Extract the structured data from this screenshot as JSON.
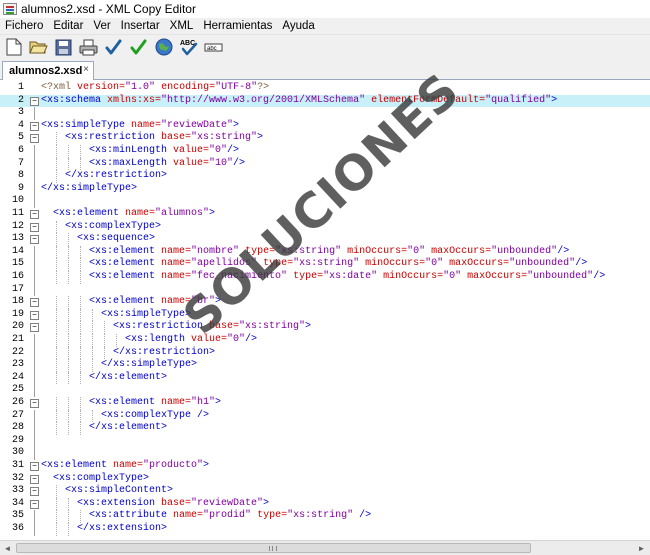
{
  "window": {
    "title": "alumnos2.xsd - XML Copy Editor"
  },
  "menubar": {
    "items": [
      "Fichero",
      "Editar",
      "Ver",
      "Insertar",
      "XML",
      "Herramientas",
      "Ayuda"
    ]
  },
  "toolbar": {
    "buttons": [
      "new-document-icon",
      "open-folder-icon",
      "save-icon",
      "print-icon",
      "check-wellformed-icon",
      "validate-icon",
      "browser-preview-icon",
      "spellcheck-icon",
      "spellcheck-alt-icon"
    ],
    "spell_label": "ABC",
    "spell_alt_label": "abc"
  },
  "tabs": [
    {
      "label": "alumnos2.xsd",
      "close": "×"
    }
  ],
  "editor": {
    "current_line": 2,
    "lines": [
      {
        "n": "1",
        "fold": "",
        "indent": 0,
        "tokens": [
          [
            "pi",
            "<?xml "
          ],
          [
            "attr",
            "version="
          ],
          [
            "val",
            "\"1.0\""
          ],
          [
            "pi",
            " "
          ],
          [
            "attr",
            "encoding="
          ],
          [
            "val",
            "\"UTF-8\""
          ],
          [
            "pi",
            "?>"
          ]
        ]
      },
      {
        "n": "2",
        "fold": "-",
        "indent": 0,
        "tokens": [
          [
            "tag",
            "<xs:schema "
          ],
          [
            "attr",
            "xmlns:xs="
          ],
          [
            "val",
            "\"http://www.w3.org/2001/XMLSchema\""
          ],
          [
            "tag",
            " "
          ],
          [
            "attr",
            "elementFormDefault="
          ],
          [
            "val",
            "\"qualified\""
          ],
          [
            "tag",
            ">"
          ]
        ]
      },
      {
        "n": "3",
        "fold": "|",
        "indent": 0,
        "tokens": []
      },
      {
        "n": "4",
        "fold": "-",
        "indent": 0,
        "tokens": [
          [
            "tag",
            "<xs:simpleType "
          ],
          [
            "attr",
            "name="
          ],
          [
            "val",
            "\"reviewDate\""
          ],
          [
            "tag",
            ">"
          ]
        ]
      },
      {
        "n": "5",
        "fold": "-",
        "indent": 2,
        "tokens": [
          [
            "tag",
            "<xs:restriction "
          ],
          [
            "attr",
            "base="
          ],
          [
            "val",
            "\"xs:string\""
          ],
          [
            "tag",
            ">"
          ]
        ]
      },
      {
        "n": "6",
        "fold": "|",
        "indent": 4,
        "tokens": [
          [
            "tag",
            "<xs:minLength "
          ],
          [
            "attr",
            "value="
          ],
          [
            "val",
            "\"0\""
          ],
          [
            "tag",
            "/>"
          ]
        ]
      },
      {
        "n": "7",
        "fold": "|",
        "indent": 4,
        "tokens": [
          [
            "tag",
            "<xs:maxLength "
          ],
          [
            "attr",
            "value="
          ],
          [
            "val",
            "\"10\""
          ],
          [
            "tag",
            "/>"
          ]
        ]
      },
      {
        "n": "8",
        "fold": "|",
        "indent": 2,
        "tokens": [
          [
            "tag",
            "</xs:restriction>"
          ]
        ]
      },
      {
        "n": "9",
        "fold": "|",
        "indent": 0,
        "tokens": [
          [
            "tag",
            "</xs:simpleType>"
          ]
        ]
      },
      {
        "n": "10",
        "fold": "|",
        "indent": 0,
        "tokens": []
      },
      {
        "n": "11",
        "fold": "-",
        "indent": 1,
        "tokens": [
          [
            "tag",
            "<xs:element "
          ],
          [
            "attr",
            "name="
          ],
          [
            "val",
            "\"alumnos\""
          ],
          [
            "tag",
            ">"
          ]
        ]
      },
      {
        "n": "12",
        "fold": "-",
        "indent": 2,
        "tokens": [
          [
            "tag",
            "<xs:complexType>"
          ]
        ]
      },
      {
        "n": "13",
        "fold": "-",
        "indent": 3,
        "tokens": [
          [
            "tag",
            "<xs:sequence>"
          ]
        ]
      },
      {
        "n": "14",
        "fold": "|",
        "indent": 4,
        "tokens": [
          [
            "tag",
            "<xs:element "
          ],
          [
            "attr",
            "name="
          ],
          [
            "val",
            "\"nombre\""
          ],
          [
            "tag",
            " "
          ],
          [
            "attr",
            "type="
          ],
          [
            "val",
            "\"xs:string\""
          ],
          [
            "tag",
            " "
          ],
          [
            "attr",
            "minOccurs="
          ],
          [
            "val",
            "\"0\""
          ],
          [
            "tag",
            " "
          ],
          [
            "attr",
            "maxOccurs="
          ],
          [
            "val",
            "\"unbounded\""
          ],
          [
            "tag",
            "/>"
          ]
        ]
      },
      {
        "n": "15",
        "fold": "|",
        "indent": 4,
        "tokens": [
          [
            "tag",
            "<xs:element "
          ],
          [
            "attr",
            "name="
          ],
          [
            "val",
            "\"apellidos\""
          ],
          [
            "tag",
            " "
          ],
          [
            "attr",
            "type="
          ],
          [
            "val",
            "\"xs:string\""
          ],
          [
            "tag",
            " "
          ],
          [
            "attr",
            "minOccurs="
          ],
          [
            "val",
            "\"0\""
          ],
          [
            "tag",
            " "
          ],
          [
            "attr",
            "maxOccurs="
          ],
          [
            "val",
            "\"unbounded\""
          ],
          [
            "tag",
            "/>"
          ]
        ]
      },
      {
        "n": "16",
        "fold": "|",
        "indent": 4,
        "tokens": [
          [
            "tag",
            "<xs:element "
          ],
          [
            "attr",
            "name="
          ],
          [
            "val",
            "\"fec_nacimiento\""
          ],
          [
            "tag",
            " "
          ],
          [
            "attr",
            "type="
          ],
          [
            "val",
            "\"xs:date\""
          ],
          [
            "tag",
            " "
          ],
          [
            "attr",
            "minOccurs="
          ],
          [
            "val",
            "\"0\""
          ],
          [
            "tag",
            " "
          ],
          [
            "attr",
            "maxOccurs="
          ],
          [
            "val",
            "\"unbounded\""
          ],
          [
            "tag",
            "/>"
          ]
        ]
      },
      {
        "n": "17",
        "fold": "|",
        "indent": 0,
        "tokens": []
      },
      {
        "n": "18",
        "fold": "-",
        "indent": 4,
        "tokens": [
          [
            "tag",
            "<xs:element "
          ],
          [
            "attr",
            "name="
          ],
          [
            "val",
            "\"br\""
          ],
          [
            "tag",
            ">"
          ]
        ]
      },
      {
        "n": "19",
        "fold": "-",
        "indent": 5,
        "tokens": [
          [
            "tag",
            "<xs:simpleType>"
          ]
        ]
      },
      {
        "n": "20",
        "fold": "-",
        "indent": 6,
        "tokens": [
          [
            "tag",
            "<xs:restriction "
          ],
          [
            "attr",
            "base="
          ],
          [
            "val",
            "\"xs:string\""
          ],
          [
            "tag",
            ">"
          ]
        ]
      },
      {
        "n": "21",
        "fold": "|",
        "indent": 7,
        "tokens": [
          [
            "tag",
            "<xs:length "
          ],
          [
            "attr",
            "value="
          ],
          [
            "val",
            "\"0\""
          ],
          [
            "tag",
            "/>"
          ]
        ]
      },
      {
        "n": "22",
        "fold": "|",
        "indent": 6,
        "tokens": [
          [
            "tag",
            "</xs:restriction>"
          ]
        ]
      },
      {
        "n": "23",
        "fold": "|",
        "indent": 5,
        "tokens": [
          [
            "tag",
            "</xs:simpleType>"
          ]
        ]
      },
      {
        "n": "24",
        "fold": "|",
        "indent": 4,
        "tokens": [
          [
            "tag",
            "</xs:element>"
          ]
        ]
      },
      {
        "n": "25",
        "fold": "|",
        "indent": 0,
        "tokens": []
      },
      {
        "n": "26",
        "fold": "-",
        "indent": 4,
        "tokens": [
          [
            "tag",
            "<xs:element "
          ],
          [
            "attr",
            "name="
          ],
          [
            "val",
            "\"h1\""
          ],
          [
            "tag",
            ">"
          ]
        ]
      },
      {
        "n": "27",
        "fold": "|",
        "indent": 5,
        "tokens": [
          [
            "tag",
            "<xs:complexType />"
          ]
        ]
      },
      {
        "n": "28",
        "fold": "|",
        "indent": 4,
        "tokens": [
          [
            "tag",
            "</xs:element>"
          ]
        ]
      },
      {
        "n": "29",
        "fold": "|",
        "indent": 0,
        "tokens": []
      },
      {
        "n": "30",
        "fold": "|",
        "indent": 0,
        "tokens": []
      },
      {
        "n": "31",
        "fold": "-",
        "indent": 0,
        "tokens": [
          [
            "tag",
            "<xs:element "
          ],
          [
            "attr",
            "name="
          ],
          [
            "val",
            "\"producto\""
          ],
          [
            "tag",
            ">"
          ]
        ]
      },
      {
        "n": "32",
        "fold": "-",
        "indent": 1,
        "tokens": [
          [
            "tag",
            "<xs:complexType>"
          ]
        ]
      },
      {
        "n": "33",
        "fold": "-",
        "indent": 2,
        "tokens": [
          [
            "tag",
            "<xs:simpleContent>"
          ]
        ]
      },
      {
        "n": "34",
        "fold": "-",
        "indent": 3,
        "tokens": [
          [
            "tag",
            "<xs:extension "
          ],
          [
            "attr",
            "base="
          ],
          [
            "val",
            "\"reviewDate\""
          ],
          [
            "tag",
            ">"
          ]
        ]
      },
      {
        "n": "35",
        "fold": "|",
        "indent": 4,
        "tokens": [
          [
            "tag",
            "<xs:attribute "
          ],
          [
            "attr",
            "name="
          ],
          [
            "val",
            "\"prodid\""
          ],
          [
            "tag",
            " "
          ],
          [
            "attr",
            "type="
          ],
          [
            "val",
            "\"xs:string\""
          ],
          [
            "tag",
            " />"
          ]
        ]
      },
      {
        "n": "36",
        "fold": "|",
        "indent": 3,
        "tokens": [
          [
            "tag",
            "</xs:extension>"
          ]
        ]
      }
    ]
  },
  "watermark": {
    "text": "SOLUCIONES"
  },
  "scrollbar": {
    "left_arrow": "◄",
    "right_arrow": "►"
  }
}
